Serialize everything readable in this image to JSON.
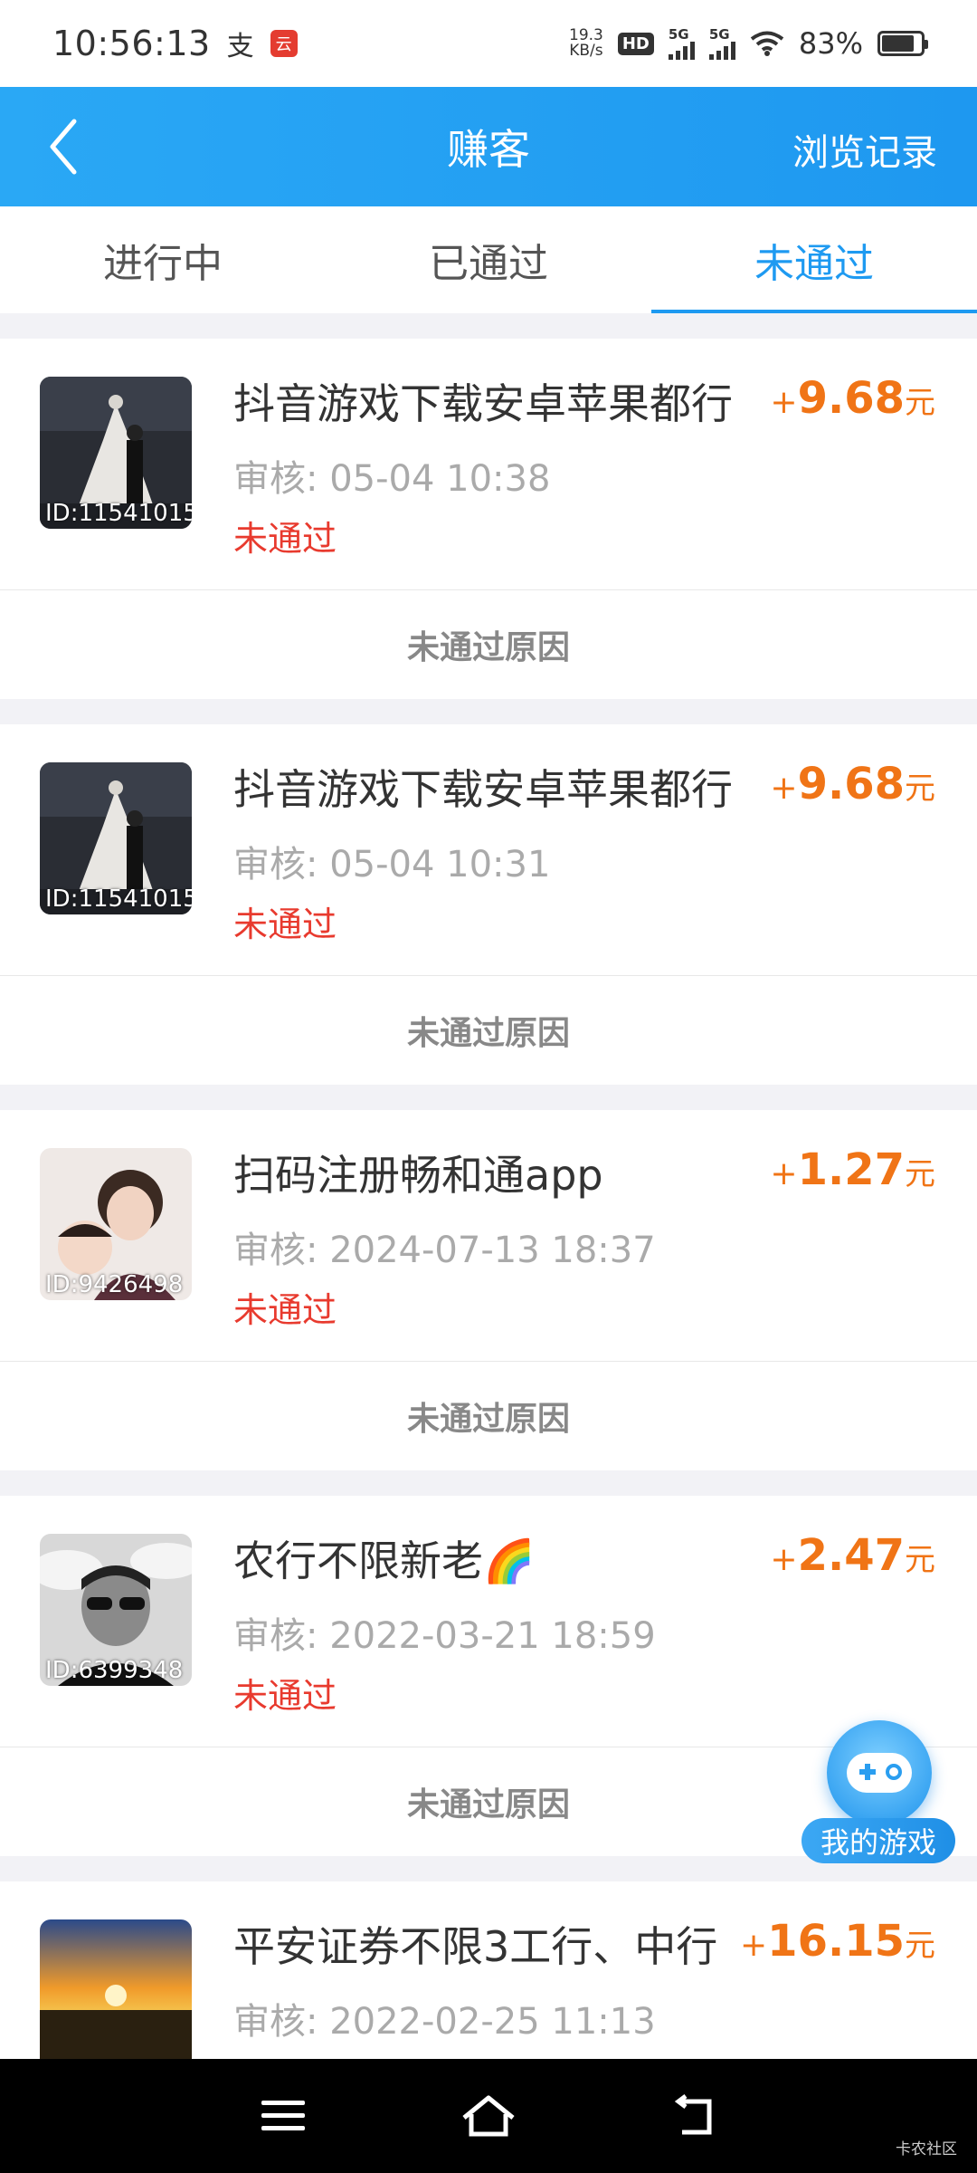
{
  "status_bar": {
    "time": "10:56:13",
    "pay_icon_char": "支",
    "app_badge_char": "云",
    "net_speed_top": "19.3",
    "net_speed_bottom": "KB/s",
    "hd_label": "HD",
    "sim1_label": "5G",
    "sim2_label": "5G",
    "battery_percent": "83%",
    "battery_level": 0.83
  },
  "header": {
    "title": "赚客",
    "right_link": "浏览记录"
  },
  "tabs": [
    {
      "label": "进行中",
      "active": false
    },
    {
      "label": "已通过",
      "active": false
    },
    {
      "label": "未通过",
      "active": true
    }
  ],
  "tasks": [
    {
      "title": "抖音游戏下载安卓苹果都行",
      "reward_plus": "+",
      "reward_amount": "9.68",
      "reward_unit": "元",
      "review_label": "审核:",
      "review_time": "05-04 10:38",
      "status": "未通过",
      "user_id": "ID:11541015",
      "reason_label": "未通过原因"
    },
    {
      "title": "抖音游戏下载安卓苹果都行",
      "reward_plus": "+",
      "reward_amount": "9.68",
      "reward_unit": "元",
      "review_label": "审核:",
      "review_time": "05-04 10:31",
      "status": "未通过",
      "user_id": "ID:11541015",
      "reason_label": "未通过原因"
    },
    {
      "title": "扫码注册畅和通app",
      "reward_plus": "+",
      "reward_amount": "1.27",
      "reward_unit": "元",
      "review_label": "审核:",
      "review_time": "2024-07-13 18:37",
      "status": "未通过",
      "user_id": "ID:9426498",
      "reason_label": "未通过原因"
    },
    {
      "title": "农行不限新老🌈",
      "reward_plus": "+",
      "reward_amount": "2.47",
      "reward_unit": "元",
      "review_label": "审核:",
      "review_time": "2022-03-21 18:59",
      "status": "未通过",
      "user_id": "ID:6399348",
      "reason_label": "未通过原因"
    },
    {
      "title": "平安证券不限3工行、中行",
      "reward_plus": "+",
      "reward_amount": "16.15",
      "reward_unit": "元",
      "review_label": "审核:",
      "review_time": "2022-02-25 11:13",
      "status": "",
      "user_id": "",
      "reason_label": ""
    }
  ],
  "float_button": {
    "label": "我的游戏",
    "icon": "gamepad-icon"
  },
  "nav": {
    "menu_icon": "menu-icon",
    "home_icon": "home-icon",
    "back_icon": "back-icon"
  },
  "watermark": "卡农社区",
  "colors": {
    "header_blue": "#1e9af1",
    "reward_orange": "#f07416",
    "fail_red": "#e83a2e"
  }
}
